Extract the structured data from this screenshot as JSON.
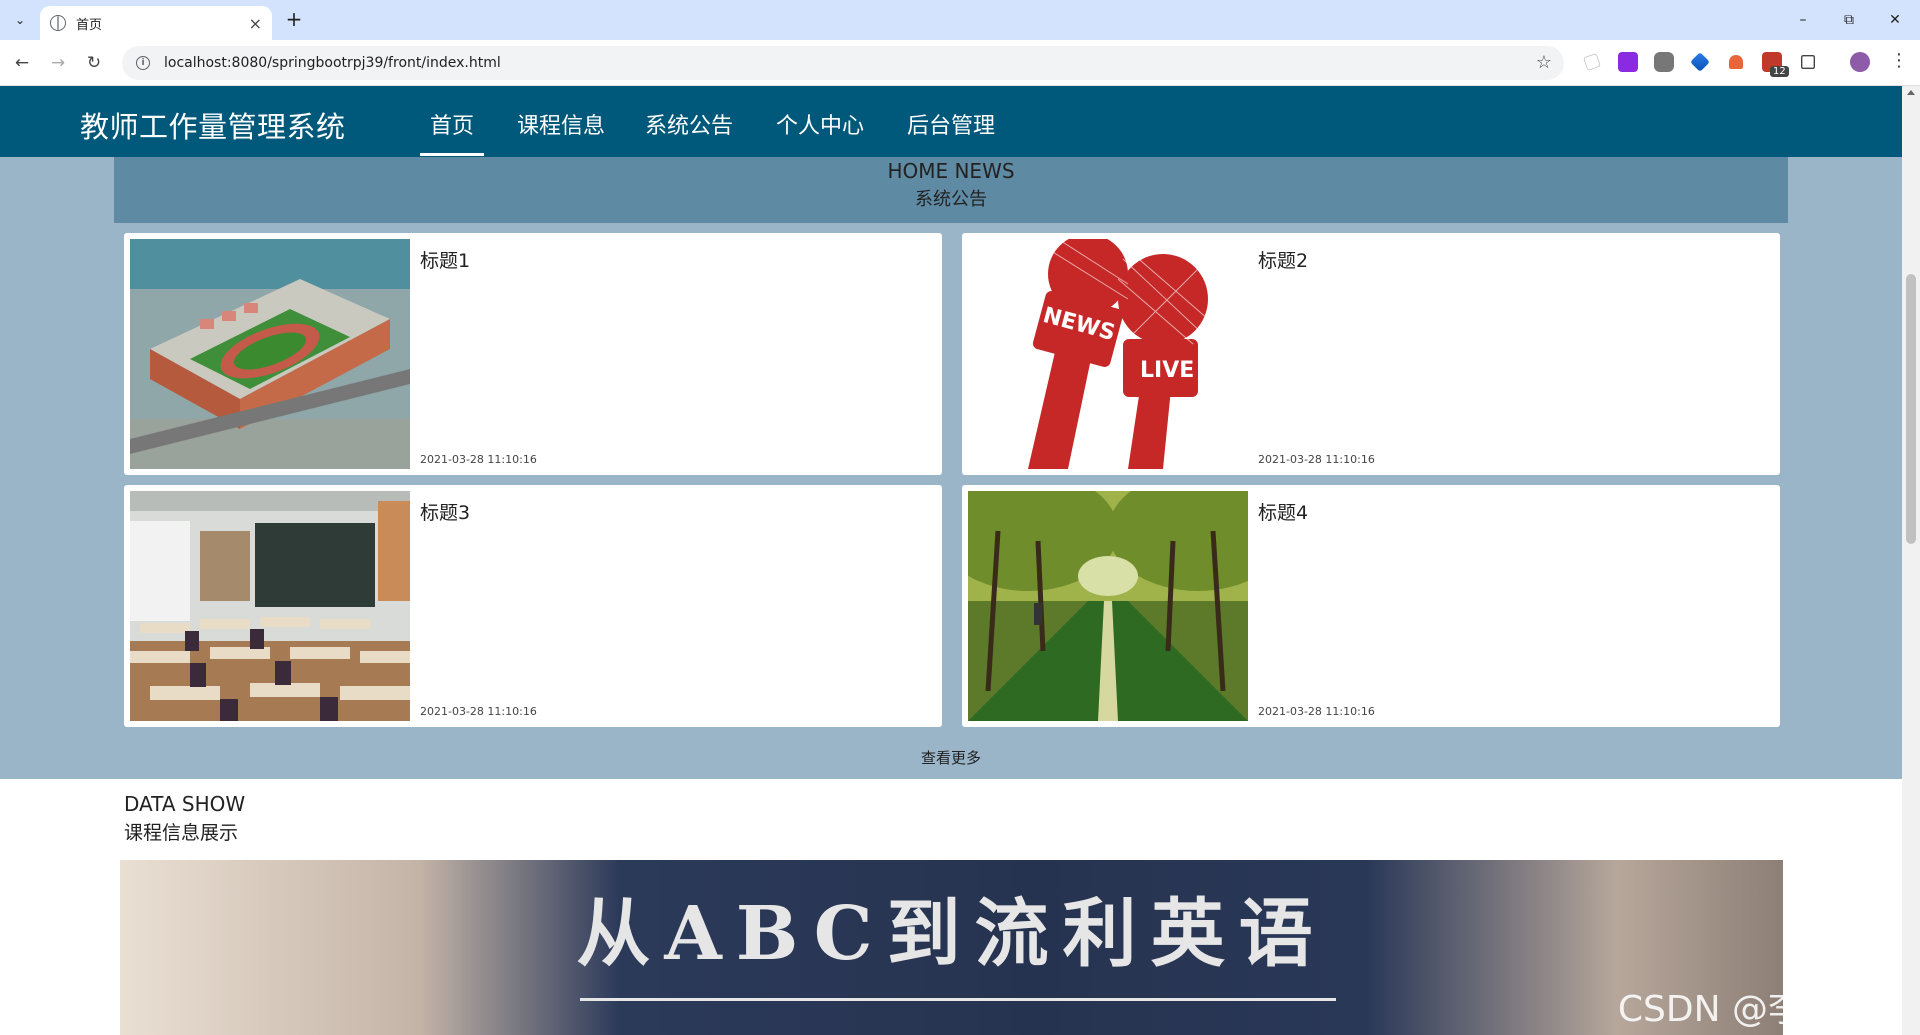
{
  "browser": {
    "tab_title": "首页",
    "url": "localhost:8080/springbootrpj39/front/index.html",
    "extension_badge": "12"
  },
  "site": {
    "title": "教师工作量管理系统",
    "nav": [
      "首页",
      "课程信息",
      "系统公告",
      "个人中心",
      "后台管理"
    ],
    "active_nav": "首页"
  },
  "news": {
    "heading_en": "HOME NEWS",
    "heading_cn": "系统公告",
    "items": [
      {
        "title": "标题1",
        "date": "2021-03-28 11:10:16",
        "image": "campus-building-image"
      },
      {
        "title": "标题2",
        "date": "2021-03-28 11:10:16",
        "image": "news-live-microphone-image",
        "image_text": [
          "NEWS",
          "LIVE"
        ]
      },
      {
        "title": "标题3",
        "date": "2021-03-28 11:10:16",
        "image": "classroom-image"
      },
      {
        "title": "标题4",
        "date": "2021-03-28 11:10:16",
        "image": "tree-lined-road-image"
      }
    ],
    "more_label": "查看更多"
  },
  "data_show": {
    "heading_en": "DATA SHOW",
    "heading_cn": "课程信息展示",
    "banner_text": "从ABC到流利英语"
  },
  "watermark": "CSDN @李白的粉",
  "colors": {
    "header_bg": "#00587a",
    "section_bg": "#9ab5c8",
    "news_head_bg": "#5f8aa3",
    "tabbar_bg": "#d3e3fd"
  }
}
